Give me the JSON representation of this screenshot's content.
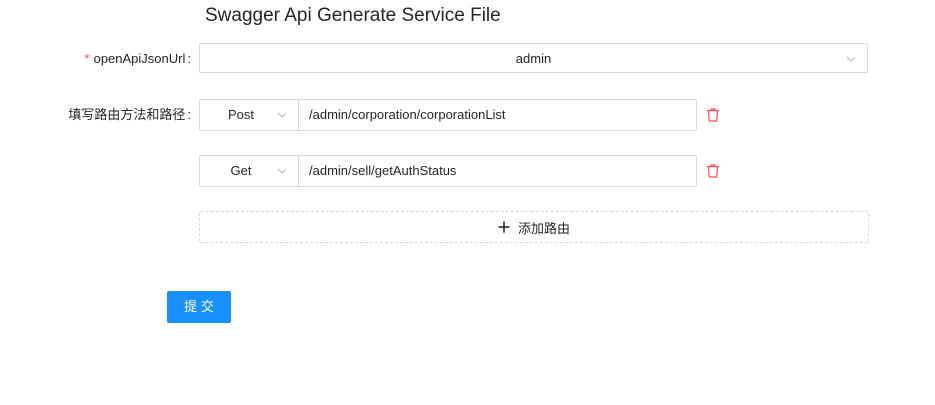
{
  "title": "Swagger Api Generate Service File",
  "form": {
    "json_url": {
      "required_mark": "*",
      "label": "openApiJsonUrl",
      "colon": ":",
      "value": "admin"
    },
    "routes": {
      "label": "填写路由方法和路径",
      "colon": ":",
      "items": [
        {
          "method": "Post",
          "path": "/admin/corporation/corporationList"
        },
        {
          "method": "Get",
          "path": "/admin/sell/getAuthStatus"
        }
      ],
      "add_label": "添加路由"
    },
    "submit_label": "提交"
  },
  "icons": {
    "chevron": "chevron-down-icon",
    "delete": "trash-icon",
    "add": "plus-icon"
  },
  "colors": {
    "primary": "#1890ff",
    "danger": "#ff4d4f",
    "border": "#d9d9d9"
  }
}
